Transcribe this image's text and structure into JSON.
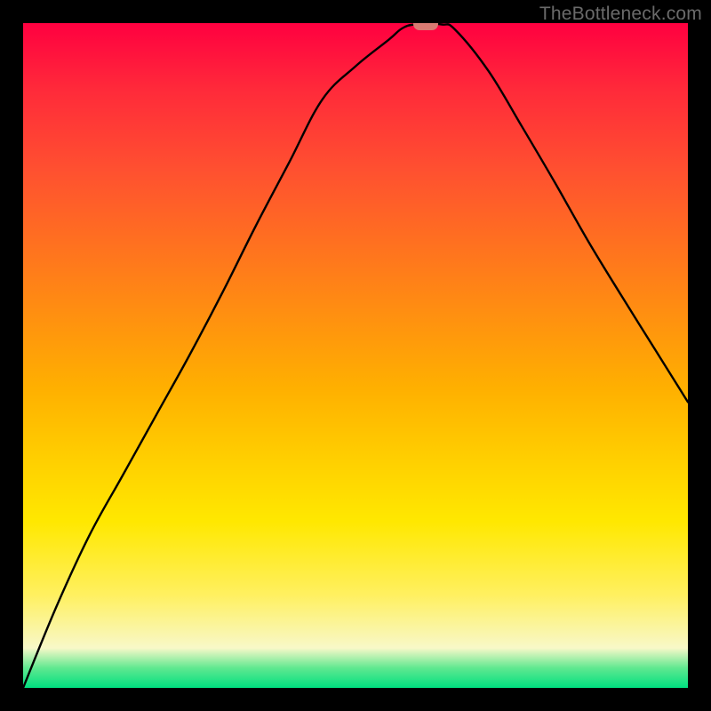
{
  "attribution": "TheBottleneck.com",
  "chart_data": {
    "type": "line",
    "title": "",
    "xlabel": "",
    "ylabel": "",
    "xlim": [
      0,
      1
    ],
    "ylim": [
      0,
      1
    ],
    "series": [
      {
        "name": "curve",
        "x": [
          0.0,
          0.05,
          0.1,
          0.15,
          0.2,
          0.25,
          0.3,
          0.35,
          0.4,
          0.45,
          0.5,
          0.55,
          0.57,
          0.59,
          0.63,
          0.65,
          0.7,
          0.75,
          0.8,
          0.85,
          0.9,
          0.95,
          1.0
        ],
        "values": [
          0.0,
          0.122,
          0.23,
          0.32,
          0.41,
          0.5,
          0.595,
          0.695,
          0.79,
          0.885,
          0.935,
          0.975,
          0.992,
          0.998,
          0.998,
          0.99,
          0.928,
          0.845,
          0.76,
          0.672,
          0.59,
          0.51,
          0.43
        ]
      }
    ],
    "marker": {
      "x": 0.605,
      "y": 0.998
    },
    "colors": {
      "curve": "#000000",
      "marker": "#d97a72",
      "frame": "#000000",
      "gradient_stops": [
        {
          "pos": 0.0,
          "color": "#ff0040"
        },
        {
          "pos": 0.55,
          "color": "#ffb000"
        },
        {
          "pos": 0.86,
          "color": "#fff060"
        },
        {
          "pos": 0.97,
          "color": "#60e890"
        },
        {
          "pos": 1.0,
          "color": "#00e080"
        }
      ]
    }
  }
}
